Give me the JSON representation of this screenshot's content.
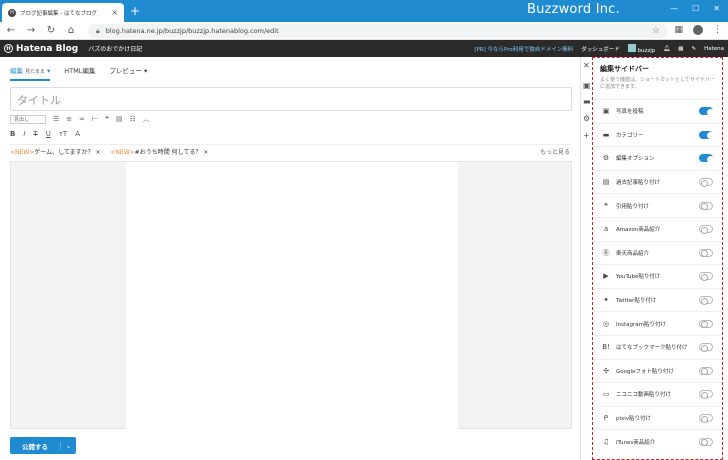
{
  "browser": {
    "tab_title": "ブログ記事編集 - はてなブログ",
    "tab_close": "×",
    "new_tab": "+",
    "brand_overlay": "Buzzword Inc.",
    "url": "blog.hatena.ne.jp/buzzjp/buzzjp.hatenablog.com/edit"
  },
  "header": {
    "logo": "Hatena Blog",
    "blog_name": "バズのおでかけ日記",
    "promo": "[PR] 今ならPro利用で独自ドメイン無料",
    "dashboard": "ダッシュボード",
    "user": "buzzjp",
    "hatena": "Hatena"
  },
  "editor": {
    "tabs": [
      {
        "label": "編集",
        "sub": "見たまま"
      },
      {
        "label": "HTML編集",
        "sub": ""
      },
      {
        "label": "プレビュー",
        "sub": ""
      }
    ],
    "title_placeholder": "タイトル",
    "heading_select": "見出し",
    "news": [
      {
        "tag": "<NEW>",
        "text": "ゲーム、してますか？"
      },
      {
        "tag": "<NEW>",
        "text": "#おうち時間 何してる？"
      }
    ],
    "news_more": "もっと見る",
    "publish_label": "公開する"
  },
  "sidebar": {
    "title": "編集サイドバー",
    "description": "よく使う機能は、ショートカットとしてサイドバーに追加できます。",
    "items": [
      {
        "icon": "photo-icon",
        "glyph": "▣",
        "label": "写真を投稿",
        "on": true
      },
      {
        "icon": "folder-icon",
        "glyph": "▬",
        "label": "カテゴリー",
        "on": true
      },
      {
        "icon": "gear-icon",
        "glyph": "⚙",
        "label": "編集オプション",
        "on": true
      },
      {
        "icon": "document-icon",
        "glyph": "▤",
        "label": "過去記事貼り付け",
        "on": false
      },
      {
        "icon": "quote-icon",
        "glyph": "❝",
        "label": "引用貼り付け",
        "on": false
      },
      {
        "icon": "amazon-icon",
        "glyph": "a",
        "label": "Amazon商品紹介",
        "on": false
      },
      {
        "icon": "rakuten-icon",
        "glyph": "Ⓡ",
        "label": "楽天商品紹介",
        "on": false
      },
      {
        "icon": "youtube-icon",
        "glyph": "▶",
        "label": "YouTube貼り付け",
        "on": false
      },
      {
        "icon": "twitter-icon",
        "glyph": "✦",
        "label": "Twitter貼り付け",
        "on": false
      },
      {
        "icon": "instagram-icon",
        "glyph": "◎",
        "label": "Instagram貼り付け",
        "on": false
      },
      {
        "icon": "bookmark-icon",
        "glyph": "B!",
        "label": "はてなブックマーク貼り付け",
        "on": false
      },
      {
        "icon": "google-photos-icon",
        "glyph": "✣",
        "label": "Googleフォト貼り付け",
        "on": false
      },
      {
        "icon": "niconico-icon",
        "glyph": "▭",
        "label": "ニコニコ動画貼り付け",
        "on": false
      },
      {
        "icon": "pixiv-icon",
        "glyph": "ᑭ",
        "label": "pixiv貼り付け",
        "on": false
      },
      {
        "icon": "music-icon",
        "glyph": "♫",
        "label": "iTunes商品紹介",
        "on": false
      }
    ]
  }
}
